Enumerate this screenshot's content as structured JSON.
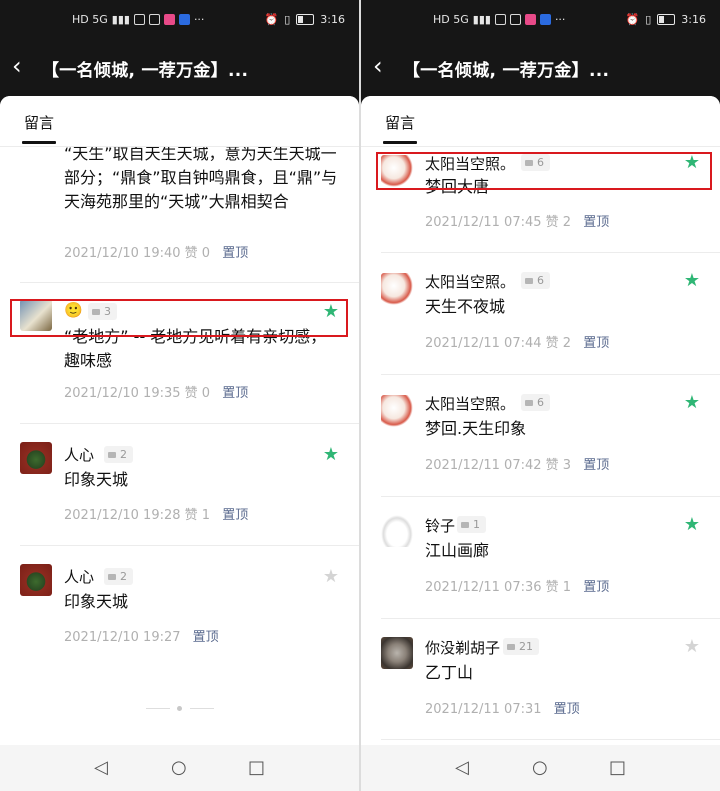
{
  "status": {
    "time": "3:16",
    "carrier_left": "HD 5G",
    "battery": "56"
  },
  "header": {
    "title": "【一名倾城, 一荐万金】..."
  },
  "tabs": [
    "留言"
  ],
  "left": {
    "items": [
      {
        "content": "“天生”取自天生天城，意为天生天城一部分；“鼎食”取自钟鸣鼎食，且“鼎”与天海苑那里的“天城”大鼎相契合",
        "time": "2021/12/10 19:40",
        "likes": "赞 0",
        "pin": "置顶"
      },
      {
        "name": "🙂",
        "replies": "3",
        "content": "“老地方” -- 老地方见听着有亲切感，趣味感",
        "time": "2021/12/10 19:35",
        "likes": "赞 0",
        "pin": "置顶",
        "starred": true
      },
      {
        "name": "人心",
        "replies": "2",
        "content": "印象天城",
        "time": "2021/12/10 19:28",
        "likes": "赞 1",
        "pin": "置顶",
        "starred": true
      },
      {
        "name": "人心",
        "replies": "2",
        "content": "印象天城",
        "time": "2021/12/10 19:27",
        "likes": "",
        "pin": "置顶",
        "starred": false
      }
    ]
  },
  "right": {
    "items": [
      {
        "name": "太阳当空照。",
        "replies": "6",
        "content": "梦回大唐",
        "time": "2021/12/11 07:45",
        "likes": "赞 2",
        "pin": "置顶",
        "starred": true
      },
      {
        "name": "太阳当空照。",
        "replies": "6",
        "content": "天生不夜城",
        "time": "2021/12/11 07:44",
        "likes": "赞 2",
        "pin": "置顶",
        "starred": true
      },
      {
        "name": "太阳当空照。",
        "replies": "6",
        "content": "梦回.天生印象",
        "time": "2021/12/11 07:42",
        "likes": "赞 3",
        "pin": "置顶",
        "starred": true
      },
      {
        "name": "铃子",
        "replies": "1",
        "content": "江山画廊",
        "time": "2021/12/11 07:36",
        "likes": "赞 1",
        "pin": "置顶",
        "starred": true
      },
      {
        "name": "你没剃胡子",
        "replies": "21",
        "content": "乙丁山",
        "time": "2021/12/11 07:31",
        "likes": "",
        "pin": "置顶",
        "starred": false
      }
    ]
  },
  "icons": {
    "back": "back-arrow-icon",
    "star": "star-icon",
    "comment": "comment-icon"
  },
  "colors": {
    "star_on": "#2fb675",
    "star_off": "#d4d4d4",
    "pin": "#5b6b8f",
    "highlight": "#d9191e"
  }
}
